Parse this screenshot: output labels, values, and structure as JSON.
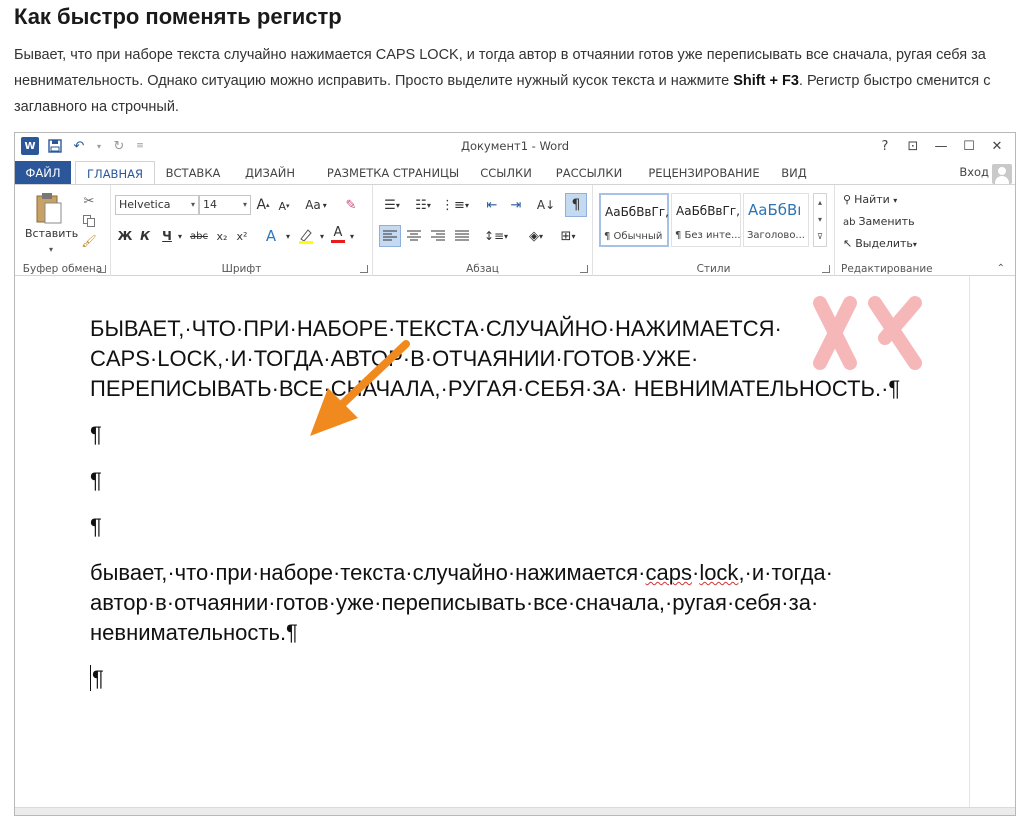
{
  "article": {
    "title": "Как быстро поменять регистр",
    "para_part1": "Бывает, что при наборе текста случайно нажимается CAPS LOCK, и тогда автор в отчаянии готов уже переписывать все сначала, ругая себя за невнимательность. Однако ситуацию можно исправить. Просто выделите нужный кусок текста и нажмите ",
    "shortcut": "Shift + F3",
    "para_part2": ". Регистр быстро сменится с заглавного на строчный."
  },
  "window": {
    "title": "Документ1 - Word",
    "logo_letter": "W",
    "controls": [
      "?",
      "⊡",
      "—",
      "☐",
      "✕"
    ],
    "signin": "Вход"
  },
  "tabs": [
    "ФАЙЛ",
    "ГЛАВНАЯ",
    "ВСТАВКА",
    "ДИЗАЙН",
    "РАЗМЕТКА СТРАНИЦЫ",
    "ССЫЛКИ",
    "РАССЫЛКИ",
    "РЕЦЕНЗИРОВАНИЕ",
    "ВИД"
  ],
  "ribbon": {
    "clipboard": {
      "paste_label": "Вставить",
      "group_label": "Буфер обмена"
    },
    "font": {
      "family": "Helvetica",
      "size": "14",
      "grow": "A",
      "shrink": "A",
      "case_btn": "Aa",
      "bold": "Ж",
      "italic": "К",
      "underline": "Ч",
      "strike": "abc",
      "subscript": "x₂",
      "superscript": "x²",
      "group_label": "Шрифт"
    },
    "paragraph": {
      "group_label": "Абзац",
      "show_marks": "¶"
    },
    "styles": {
      "items": [
        {
          "sample": "АаБбВвГг,",
          "name": "¶ Обычный"
        },
        {
          "sample": "АаБбВвГг,",
          "name": "¶ Без инте..."
        },
        {
          "sample": "АаБбВı",
          "name": "Заголово..."
        }
      ],
      "group_label": "Стили"
    },
    "editing": {
      "find": "Найти",
      "replace": "Заменить",
      "select": "Выделить",
      "group_label": "Редактирование"
    }
  },
  "document": {
    "upper_text": "БЫВАЕТ,·ЧТО·ПРИ·НАБОРЕ·ТЕКСТА·СЛУЧАЙНО·НАЖИМАЕТСЯ· CAPS·LOCK,·И·ТОГДА·АВТОР·В·ОТЧАЯНИИ·ГОТОВ·УЖЕ· ПЕРЕПИСЫВАТЬ·ВСЕ·СНАЧАЛА,·РУГАЯ·СЕБЯ·ЗА· НЕВНИМАТЕЛЬНОСТЬ.·¶",
    "pilcrow": "¶",
    "lower_before": "бывает,·что·при·наборе·текста·случайно·нажимается·",
    "lower_spell1": "caps",
    "lower_mid": "·",
    "lower_spell2": "lock",
    "lower_after": ",·и·тогда· автор·в·отчаянии·готов·уже·переписывать·все·сначала,·ругая·себя·за· невнимательность.¶",
    "last_pilcrow": "¶"
  },
  "colors": {
    "word_blue": "#2b579a",
    "arrow_orange": "#f08a1e",
    "watermark_red": "#e8333a"
  }
}
